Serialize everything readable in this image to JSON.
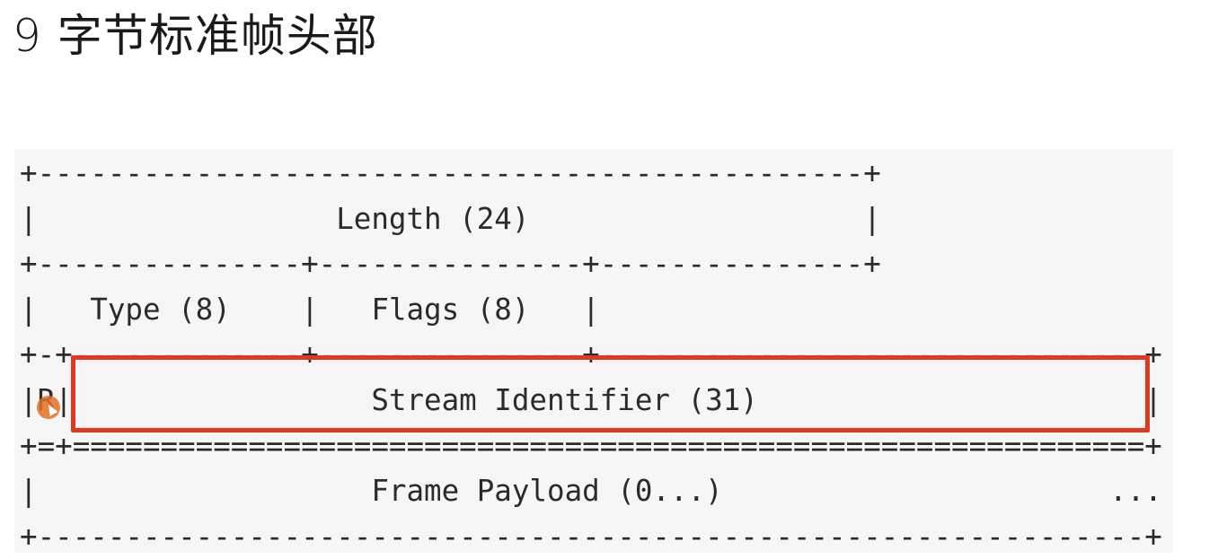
{
  "header": {
    "title": "9 字节标准帧头部"
  },
  "frame_diagram": {
    "lines": [
      "+-----------------------------------------------+",
      "|                 Length (24)                   |",
      "+---------------+---------------+---------------+",
      "|   Type (8)    |   Flags (8)   |",
      "+-+-------------+---------------+-------------------------------+",
      "|R|                 Stream Identifier (31)                      |",
      "+=+=============================================================+",
      "|                   Frame Payload (0...)                      ...",
      "+---------------------------------------------------------------+"
    ]
  },
  "annotation": {
    "highlight_color": "#e03a1e",
    "cursor_color": "#e27028",
    "cursor_icon": "cursor-pointer-icon"
  }
}
